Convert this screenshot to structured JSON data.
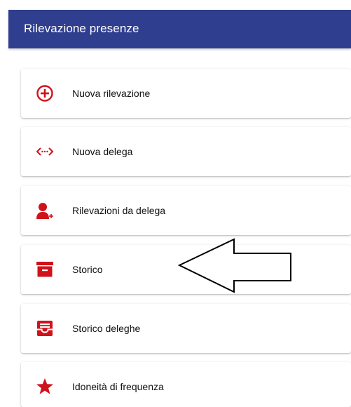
{
  "header": {
    "title": "Rilevazione presenze",
    "color": "#2f3e8e"
  },
  "accent_color": "#d0121b",
  "menu": {
    "items": [
      {
        "label": "Nuova rilevazione",
        "icon": "add-circle-icon"
      },
      {
        "label": "Nuova delega",
        "icon": "code-dots-icon"
      },
      {
        "label": "Rilevazioni da delega",
        "icon": "person-add-icon"
      },
      {
        "label": "Storico",
        "icon": "archive-icon"
      },
      {
        "label": "Storico deleghe",
        "icon": "inbox-icon"
      },
      {
        "label": "Idoneità di frequenza",
        "icon": "star-icon"
      }
    ]
  }
}
